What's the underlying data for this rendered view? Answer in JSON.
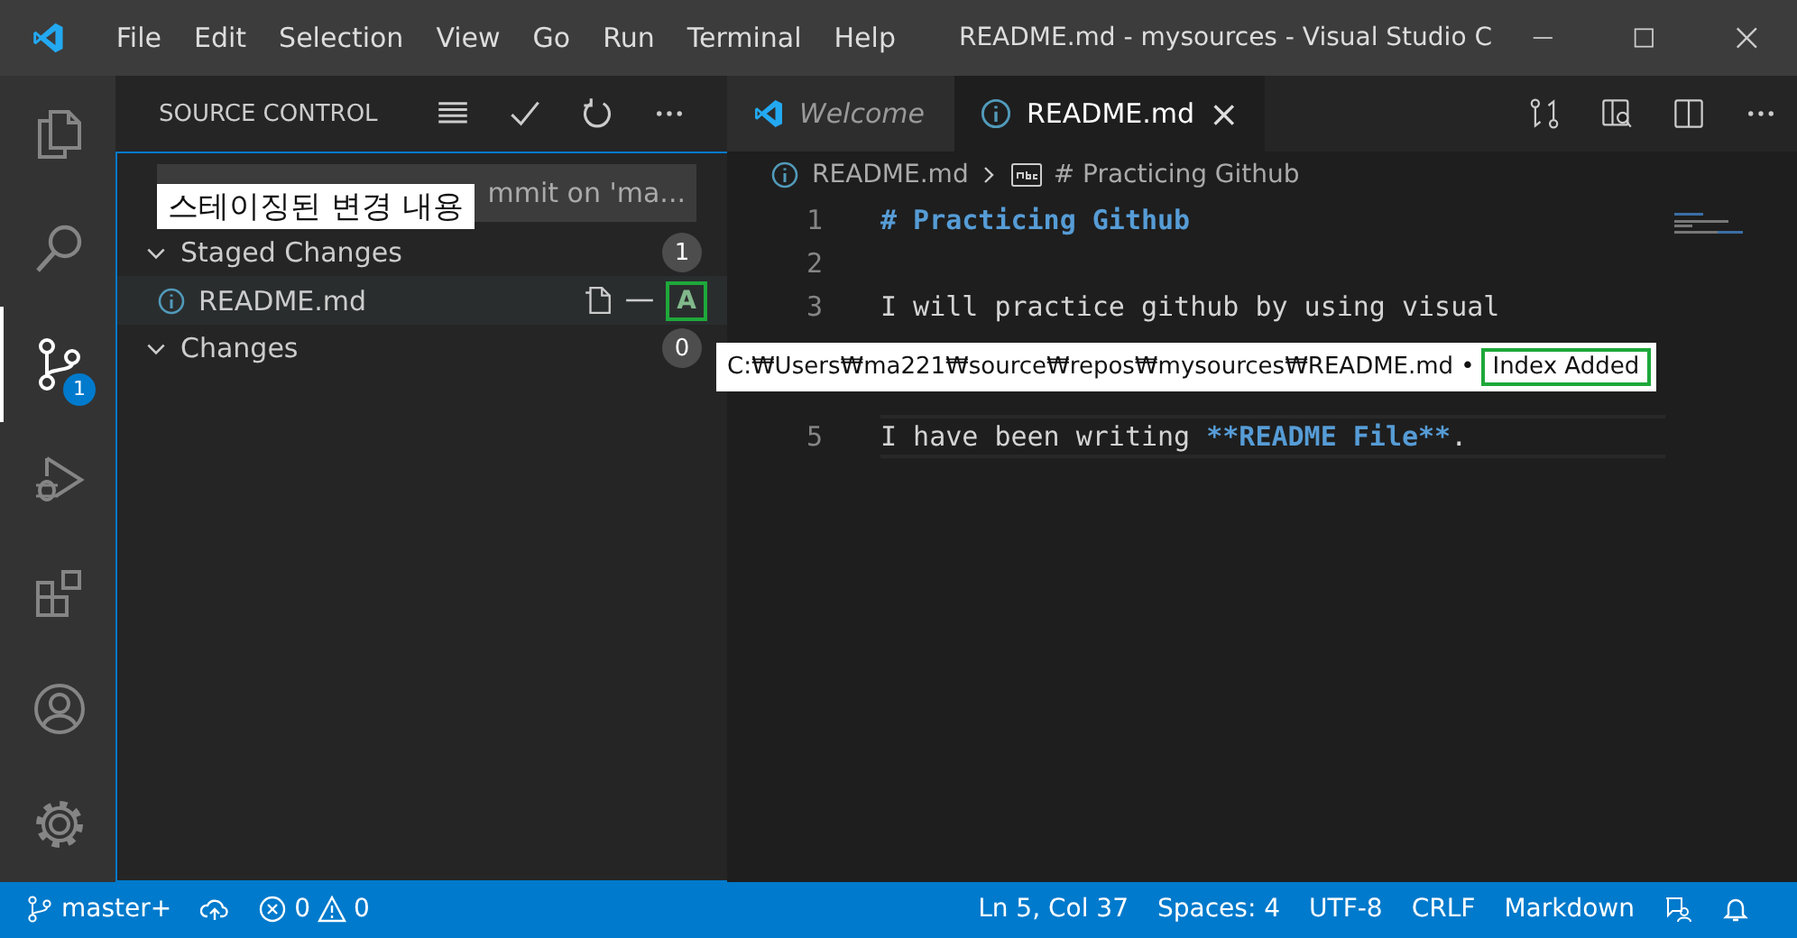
{
  "window": {
    "title": "README.md - mysources - Visual Studio C"
  },
  "menu": [
    "File",
    "Edit",
    "Selection",
    "View",
    "Go",
    "Run",
    "Terminal",
    "Help"
  ],
  "activity_bar": [
    {
      "kind": "explorer",
      "selected": false
    },
    {
      "kind": "search",
      "selected": false
    },
    {
      "kind": "source-control",
      "selected": true,
      "badge": "1"
    },
    {
      "kind": "debug",
      "selected": false
    },
    {
      "kind": "extensions",
      "selected": false
    },
    {
      "kind": "accounts",
      "selected": false
    },
    {
      "kind": "settings",
      "selected": false
    }
  ],
  "sidebar": {
    "title": "SOURCE CONTROL",
    "commit": {
      "placeholder": "mmit on 'ma..."
    },
    "annotation": "스테이징된 변경 내용",
    "groups": [
      {
        "label": "Staged Changes",
        "count": "1",
        "expanded": true,
        "files": [
          {
            "name": "README.md",
            "status": "A",
            "highlighted": true
          }
        ]
      },
      {
        "label": "Changes",
        "count": "0",
        "expanded": true
      }
    ]
  },
  "tabs": [
    {
      "label": "Welcome",
      "kind": "welcome",
      "selected": false
    },
    {
      "label": "README.md",
      "kind": "file",
      "selected": true,
      "close": "×"
    }
  ],
  "breadcrumb": [
    "README.md",
    "# Practicing Github"
  ],
  "editor": {
    "lines": [
      {
        "number": "1",
        "current": false,
        "tokens": [
          {
            "kind": "heading",
            "text": "# Practicing Github"
          }
        ]
      },
      {
        "number": "2",
        "current": false
      },
      {
        "number": "3",
        "current": false,
        "tokens": [
          {
            "kind": "plain",
            "text": "I will practice github by using visual"
          }
        ]
      },
      {
        "number": "5",
        "current": true,
        "tokens": [
          {
            "kind": "plain",
            "text": "I have been writing "
          },
          {
            "kind": "strong",
            "text": "**README File**"
          },
          {
            "kind": "plain",
            "text": "."
          }
        ]
      }
    ]
  },
  "tooltip": {
    "path": "C:₩Users₩ma221₩source₩repos₩mysources₩README.md",
    "separator": "•",
    "status": "Index Added",
    "highlighted": true
  },
  "status_bar": {
    "branch": "master+",
    "errors": "0",
    "warnings": "0",
    "items": [
      "Ln 5, Col 37",
      "Spaces: 4",
      "UTF-8",
      "CRLF",
      "Markdown"
    ]
  }
}
